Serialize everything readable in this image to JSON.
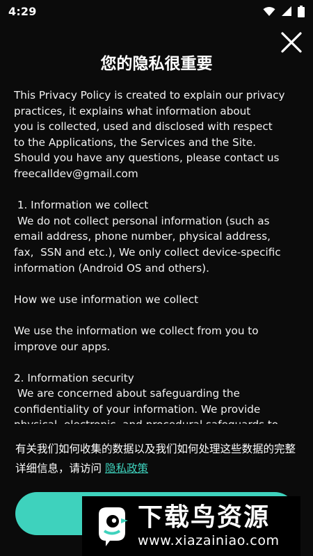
{
  "status_bar": {
    "time": "4:29",
    "icons": [
      "wifi-icon",
      "signal-icon",
      "battery-icon"
    ]
  },
  "dialog": {
    "title": "您的隐私很重要",
    "close_icon": "close-icon",
    "policy_text": "This Privacy Policy is created to explain our privacy\npractices, it explains what information about\nyou is collected, used and disclosed with respect\nto the Applications, the Services and the Site.\nShould you have any questions, please contact us\nfreecalldev@gmail.com\n\n 1. Information we collect\n We do not collect personal information (such as\nemail address, phone number, physical address,\nfax,  SSN and etc.), We only collect device-specific\ninformation (Android OS and others).\n\nHow we use information we collect\n\nWe use the information we collect from you to\nimprove our apps.\n\n2. Information security\n We are concerned about safeguarding the\nconfidentiality of your information. We provide\nphysical, electronic, and procedural safeguards to",
    "notice_text": "有关我们如何收集的数据以及我们如何处理这些数据的完整详细信息，请访问 ",
    "privacy_link": "隐私政策"
  },
  "watermark": {
    "name": "下载鸟资源",
    "url": "www.xiazainiao.com"
  },
  "colors": {
    "background": "#0b0b0b",
    "accent": "#3ed2bd",
    "text": "#ffffff"
  }
}
